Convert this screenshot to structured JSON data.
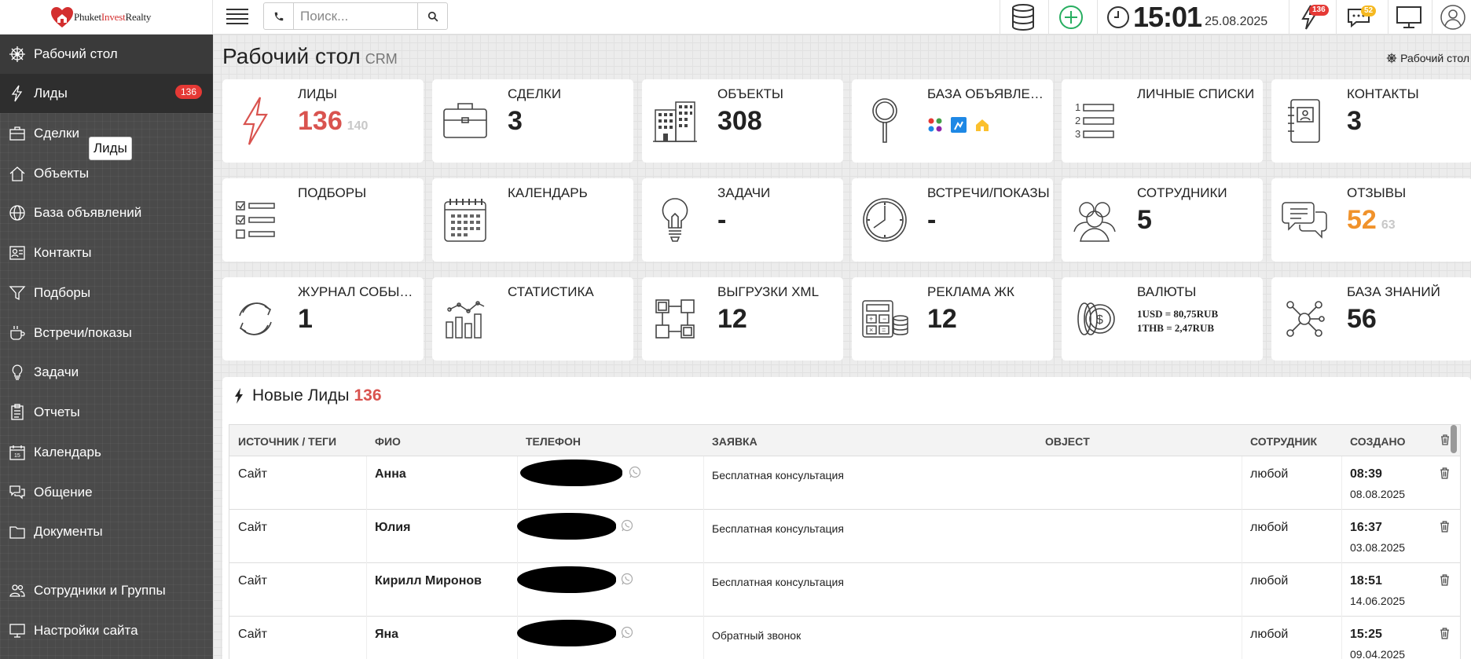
{
  "app": {
    "logo_part1": "Phuket",
    "logo_part2": "Invest",
    "logo_part3": "Realty"
  },
  "topbar": {
    "search_placeholder": "Поиск...",
    "time": "15:01",
    "date": "25.08.2025",
    "leads_badge": "136",
    "messages_badge": "52",
    "accent_color": "#27ae60",
    "badge_color": "#e53935"
  },
  "sidebar": {
    "items": [
      {
        "label": "Рабочий стол",
        "icon": "dashboard-icon"
      },
      {
        "label": "Лиды",
        "icon": "bolt-icon",
        "badge": "136"
      },
      {
        "label": "Сделки",
        "icon": "briefcase-icon"
      },
      {
        "label": "Объекты",
        "icon": "home-icon"
      },
      {
        "label": "База объявлений",
        "icon": "globe-icon"
      },
      {
        "label": "Контакты",
        "icon": "contact-card-icon"
      },
      {
        "label": "Подборы",
        "icon": "filter-icon"
      },
      {
        "label": "Встречи/показы",
        "icon": "coffee-icon"
      },
      {
        "label": "Задачи",
        "icon": "lightbulb-icon"
      },
      {
        "label": "Отчеты",
        "icon": "clipboard-icon"
      },
      {
        "label": "Календарь",
        "icon": "calendar-icon"
      },
      {
        "label": "Общение",
        "icon": "chat-icon"
      },
      {
        "label": "Документы",
        "icon": "folder-icon"
      },
      {
        "label": "Сотрудники и Группы",
        "icon": "users-icon"
      },
      {
        "label": "Настройки сайта",
        "icon": "monitor-icon"
      }
    ],
    "tooltip": "Лиды"
  },
  "page": {
    "title": "Рабочий стол",
    "subtitle": "CRM",
    "breadcrumb": "Рабочий стол"
  },
  "tiles": [
    {
      "label": "ЛИДЫ",
      "value": "136",
      "secondary": "140",
      "icon": "bolt-icon"
    },
    {
      "label": "СДЕЛКИ",
      "value": "3",
      "icon": "briefcase-icon"
    },
    {
      "label": "ОБЪЕКТЫ",
      "value": "308",
      "icon": "building-icon"
    },
    {
      "label": "БАЗА ОБЪЯВЛЕНИЙ",
      "value": "",
      "icon": "magnifier-icon"
    },
    {
      "label": "ЛИЧНЫЕ СПИСКИ",
      "value": "",
      "icon": "numbered-list-icon"
    },
    {
      "label": "КОНТАКТЫ",
      "value": "3",
      "icon": "address-book-icon"
    },
    {
      "label": "ПОДБОРЫ",
      "value": "",
      "icon": "checklist-icon"
    },
    {
      "label": "КАЛЕНДАРЬ",
      "value": "",
      "icon": "calendar-icon"
    },
    {
      "label": "ЗАДАЧИ",
      "value": "-",
      "icon": "lightbulb-icon"
    },
    {
      "label": "ВСТРЕЧИ/ПОКАЗЫ",
      "value": "-",
      "icon": "clock-icon"
    },
    {
      "label": "СОТРУДНИКИ",
      "value": "5",
      "icon": "people-icon"
    },
    {
      "label": "ОТЗЫВЫ",
      "value": "52",
      "secondary": "63",
      "icon": "speech-bubbles-icon"
    },
    {
      "label": "ЖУРНАЛ СОБЫТИЙ",
      "value": "1",
      "icon": "refresh-icon"
    },
    {
      "label": "СТАТИСТИКА",
      "value": "",
      "icon": "bar-chart-icon"
    },
    {
      "label": "ВЫГРУЗКИ XML",
      "value": "12",
      "icon": "network-icon"
    },
    {
      "label": "РЕКЛАМА ЖК",
      "value": "12",
      "icon": "calculator-coins-icon"
    },
    {
      "label": "ВАЛЮТЫ",
      "currency_line1": "1USD = 80,75RUB",
      "currency_line2": "1THB = 2,47RUB",
      "icon": "coins-icon"
    },
    {
      "label": "БАЗА ЗНАНИЙ",
      "value": "56",
      "icon": "hub-icon"
    }
  ],
  "leads_panel": {
    "title": "Новые Лиды",
    "count": "136",
    "columns": [
      "ИСТОЧНИК / ТЕГИ",
      "ФИО",
      "ТЕЛЕФОН",
      "ЗАЯВКА",
      "OBJECT",
      "СОТРУДНИК",
      "СОЗДАНО"
    ],
    "rows": [
      {
        "source": "Сайт",
        "name": "Анна",
        "request": "Бесплатная консультация",
        "object": "",
        "employee": "любой",
        "time": "08:39",
        "date": "08.08.2025"
      },
      {
        "source": "Сайт",
        "name": "Юлия",
        "request": "Бесплатная консультация",
        "object": "",
        "employee": "любой",
        "time": "16:37",
        "date": "03.08.2025"
      },
      {
        "source": "Сайт",
        "name": "Кирилл Миронов",
        "request": "Бесплатная консультация",
        "object": "",
        "employee": "любой",
        "time": "18:51",
        "date": "14.06.2025"
      },
      {
        "source": "Сайт",
        "name": "Яна",
        "request": "Обратный звонок",
        "object": "",
        "employee": "любой",
        "time": "15:25",
        "date": "09.04.2025"
      }
    ]
  }
}
